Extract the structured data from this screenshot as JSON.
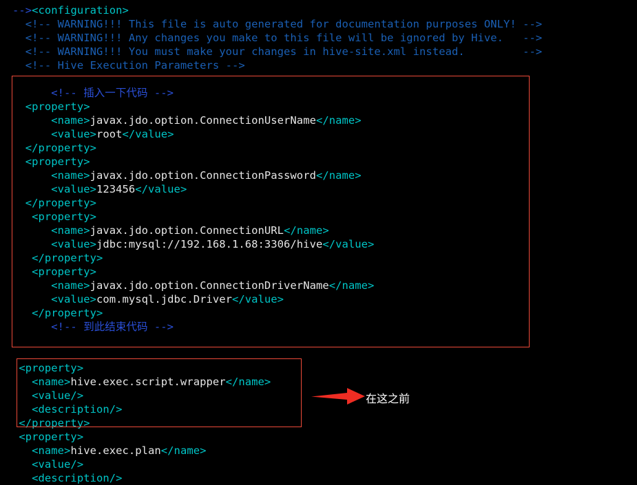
{
  "terminal": {
    "background": "#000000",
    "default_text_color": "#d8d8d8",
    "comment_color": "#1a5fb4",
    "cn_comment_color": "#2a4fd8",
    "tag_color": "#00c5c7",
    "value_color": "#e6e6e6",
    "annotation_color": "#ef4b3a",
    "lines": [
      {
        "id": "l0",
        "indent": 0,
        "segments": [
          {
            "cls": "t-cncomment",
            "text": "-->"
          },
          {
            "cls": "t-tag",
            "text": "<configuration>"
          }
        ]
      },
      {
        "id": "l1",
        "indent": 0,
        "segments": [
          {
            "cls": "t-comment",
            "text": "  <!-- WARNING!!! This file is auto generated for documentation purposes ONLY! -->"
          }
        ]
      },
      {
        "id": "l2",
        "indent": 0,
        "segments": [
          {
            "cls": "t-comment",
            "text": "  <!-- WARNING!!! Any changes you make to this file will be ignored by Hive.   -->"
          }
        ]
      },
      {
        "id": "l3",
        "indent": 0,
        "segments": [
          {
            "cls": "t-comment",
            "text": "  <!-- WARNING!!! You must make your changes in hive-site.xml instead.         -->"
          }
        ]
      },
      {
        "id": "l4",
        "indent": 0,
        "segments": [
          {
            "cls": "t-comment",
            "text": "  <!-- Hive Execution Parameters -->"
          }
        ]
      },
      {
        "id": "l5",
        "indent": 0,
        "segments": [
          {
            "cls": "t-text",
            "text": ""
          }
        ]
      },
      {
        "id": "l6",
        "indent": 0,
        "segments": [
          {
            "cls": "t-cncomment",
            "text": "      <!-- 插入一下代码 -->"
          }
        ]
      },
      {
        "id": "l7",
        "indent": 0,
        "segments": [
          {
            "cls": "t-tag",
            "text": "  <property>"
          }
        ]
      },
      {
        "id": "l8",
        "indent": 0,
        "segments": [
          {
            "cls": "t-tag",
            "text": "      <name>"
          },
          {
            "cls": "t-text",
            "text": "javax.jdo.option.ConnectionUserName"
          },
          {
            "cls": "t-tag",
            "text": "</name>"
          }
        ]
      },
      {
        "id": "l9",
        "indent": 0,
        "segments": [
          {
            "cls": "t-tag",
            "text": "      <value>"
          },
          {
            "cls": "t-text",
            "text": "root"
          },
          {
            "cls": "t-tag",
            "text": "</value>"
          }
        ]
      },
      {
        "id": "l10",
        "indent": 0,
        "segments": [
          {
            "cls": "t-tag",
            "text": "  </property>"
          }
        ]
      },
      {
        "id": "l11",
        "indent": 0,
        "segments": [
          {
            "cls": "t-tag",
            "text": "  <property>"
          }
        ]
      },
      {
        "id": "l12",
        "indent": 0,
        "segments": [
          {
            "cls": "t-tag",
            "text": "      <name>"
          },
          {
            "cls": "t-text",
            "text": "javax.jdo.option.ConnectionPassword"
          },
          {
            "cls": "t-tag",
            "text": "</name>"
          }
        ]
      },
      {
        "id": "l13",
        "indent": 0,
        "segments": [
          {
            "cls": "t-tag",
            "text": "      <value>"
          },
          {
            "cls": "t-text",
            "text": "123456"
          },
          {
            "cls": "t-tag",
            "text": "</value>"
          }
        ]
      },
      {
        "id": "l14",
        "indent": 0,
        "segments": [
          {
            "cls": "t-tag",
            "text": "  </property>"
          }
        ]
      },
      {
        "id": "l15",
        "indent": 0,
        "segments": [
          {
            "cls": "t-tag",
            "text": "   <property>"
          }
        ]
      },
      {
        "id": "l16",
        "indent": 0,
        "segments": [
          {
            "cls": "t-tag",
            "text": "      <name>"
          },
          {
            "cls": "t-text",
            "text": "javax.jdo.option.ConnectionURL"
          },
          {
            "cls": "t-tag",
            "text": "</name>"
          }
        ]
      },
      {
        "id": "l17",
        "indent": 0,
        "segments": [
          {
            "cls": "t-tag",
            "text": "      <value>"
          },
          {
            "cls": "t-text",
            "text": "jdbc:mysql://192.168.1.68:3306/hive"
          },
          {
            "cls": "t-tag",
            "text": "</value>"
          }
        ]
      },
      {
        "id": "l18",
        "indent": 0,
        "segments": [
          {
            "cls": "t-tag",
            "text": "   </property>"
          }
        ]
      },
      {
        "id": "l19",
        "indent": 0,
        "segments": [
          {
            "cls": "t-tag",
            "text": "   <property>"
          }
        ]
      },
      {
        "id": "l20",
        "indent": 0,
        "segments": [
          {
            "cls": "t-tag",
            "text": "      <name>"
          },
          {
            "cls": "t-text",
            "text": "javax.jdo.option.ConnectionDriverName"
          },
          {
            "cls": "t-tag",
            "text": "</name>"
          }
        ]
      },
      {
        "id": "l21",
        "indent": 0,
        "segments": [
          {
            "cls": "t-tag",
            "text": "      <value>"
          },
          {
            "cls": "t-text",
            "text": "com.mysql.jdbc.Driver"
          },
          {
            "cls": "t-tag",
            "text": "</value>"
          }
        ]
      },
      {
        "id": "l22",
        "indent": 0,
        "segments": [
          {
            "cls": "t-tag",
            "text": "   </property>"
          }
        ]
      },
      {
        "id": "l23",
        "indent": 0,
        "segments": [
          {
            "cls": "t-cncomment",
            "text": "      <!-- 到此结束代码 -->"
          }
        ]
      },
      {
        "id": "l24",
        "indent": 0,
        "segments": [
          {
            "cls": "t-text",
            "text": ""
          }
        ]
      },
      {
        "id": "l25",
        "indent": 0,
        "segments": [
          {
            "cls": "t-text",
            "text": ""
          }
        ]
      },
      {
        "id": "l26",
        "indent": 0,
        "segments": [
          {
            "cls": "t-tag",
            "text": " <property>"
          }
        ]
      },
      {
        "id": "l27",
        "indent": 0,
        "segments": [
          {
            "cls": "t-tag",
            "text": "   <name>"
          },
          {
            "cls": "t-text",
            "text": "hive.exec.script.wrapper"
          },
          {
            "cls": "t-tag",
            "text": "</name>"
          }
        ]
      },
      {
        "id": "l28",
        "indent": 0,
        "segments": [
          {
            "cls": "t-tag",
            "text": "   <value/>"
          }
        ]
      },
      {
        "id": "l29",
        "indent": 0,
        "segments": [
          {
            "cls": "t-tag",
            "text": "   <description/>"
          }
        ]
      },
      {
        "id": "l30",
        "indent": 0,
        "segments": [
          {
            "cls": "t-tag",
            "text": " </property>"
          }
        ]
      },
      {
        "id": "l31",
        "indent": 0,
        "segments": [
          {
            "cls": "t-tag",
            "text": " <property>"
          }
        ]
      },
      {
        "id": "l32",
        "indent": 0,
        "segments": [
          {
            "cls": "t-tag",
            "text": "   <name>"
          },
          {
            "cls": "t-text",
            "text": "hive.exec.plan"
          },
          {
            "cls": "t-tag",
            "text": "</name>"
          }
        ]
      },
      {
        "id": "l33",
        "indent": 0,
        "segments": [
          {
            "cls": "t-tag",
            "text": "   <value/>"
          }
        ]
      },
      {
        "id": "l34",
        "indent": 0,
        "segments": [
          {
            "cls": "t-tag",
            "text": "   <description/>"
          }
        ]
      }
    ]
  },
  "annotations": {
    "top_box": {
      "label": "insert-code-region-highlight"
    },
    "bottom_box": {
      "label": "first-property-highlight"
    },
    "arrow": {
      "label": "arrow-pointing-right",
      "color": "#ef4b3a"
    },
    "note_text": "在这之前"
  }
}
